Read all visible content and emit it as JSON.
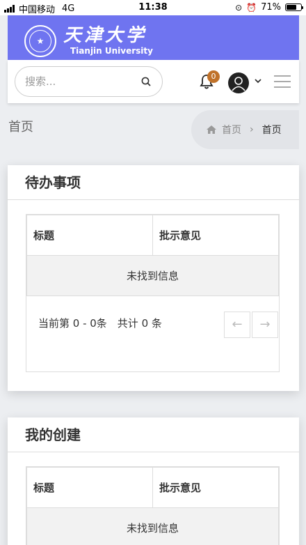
{
  "status_bar": {
    "carrier": "中国移动",
    "network": "4G",
    "time": "11:38",
    "battery": "71%",
    "battery_level": 0.71
  },
  "header": {
    "logo_cn": "天津大学",
    "logo_en": "Tianjin University"
  },
  "search": {
    "placeholder": "搜索..."
  },
  "notifications": {
    "count": "0"
  },
  "page": {
    "title": "首页"
  },
  "breadcrumb": {
    "home": "首页",
    "separator": "›",
    "current": "首页"
  },
  "todo": {
    "title": "待办事项",
    "columns": [
      "标题",
      "批示意见"
    ],
    "empty_text": "未找到信息",
    "pager_text": "当前第 0 - 0条　共计 0 条",
    "prev": "←",
    "next": "→"
  },
  "created": {
    "title": "我的创建",
    "columns": [
      "标题",
      "批示意见"
    ],
    "empty_text": "未找到信息"
  },
  "colors": {
    "brand": "#6f74f0",
    "badge": "#c0722a"
  },
  "icons": [
    "search-icon",
    "bell-icon",
    "avatar-icon",
    "chevron-down-icon",
    "menu-icon",
    "home-icon",
    "alarm-icon"
  ]
}
